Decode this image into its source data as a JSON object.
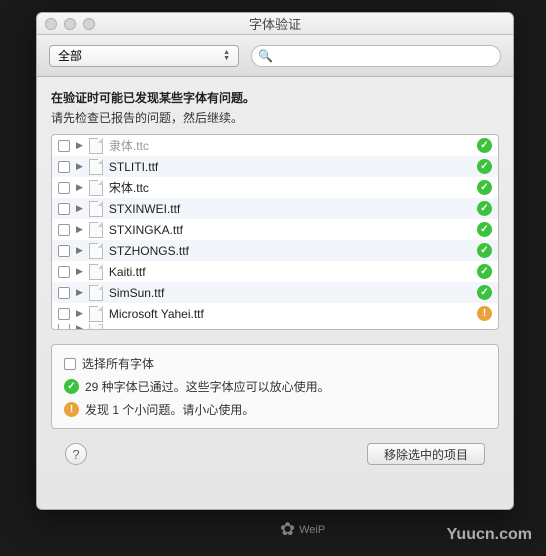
{
  "window": {
    "title": "字体验证"
  },
  "toolbar": {
    "filter_label": "全部",
    "search_placeholder": ""
  },
  "messages": {
    "line1": "在验证时可能已发现某些字体有问题。",
    "line2": "请先检查已报告的问题，然后继续。"
  },
  "fonts": [
    {
      "name": "隶体.ttc",
      "status": "ok",
      "partial": true
    },
    {
      "name": "STLITI.ttf",
      "status": "ok"
    },
    {
      "name": "宋体.ttc",
      "status": "ok"
    },
    {
      "name": "STXINWEI.ttf",
      "status": "ok"
    },
    {
      "name": "STXINGKA.ttf",
      "status": "ok"
    },
    {
      "name": "STZHONGS.ttf",
      "status": "ok"
    },
    {
      "name": "Kaiti.ttf",
      "status": "ok"
    },
    {
      "name": "SimSun.ttf",
      "status": "ok"
    },
    {
      "name": "Microsoft Yahei.ttf",
      "status": "warn"
    }
  ],
  "summary": {
    "select_all_label": "选择所有字体",
    "passed": "29 种字体已通过。这些字体应可以放心使用。",
    "warned": "发现 1 个小问题。请小心使用。"
  },
  "footer": {
    "help": "?",
    "remove_label": "移除选中的项目"
  },
  "watermarks": {
    "site": "Yuucn.com",
    "brand": "WeiP"
  }
}
